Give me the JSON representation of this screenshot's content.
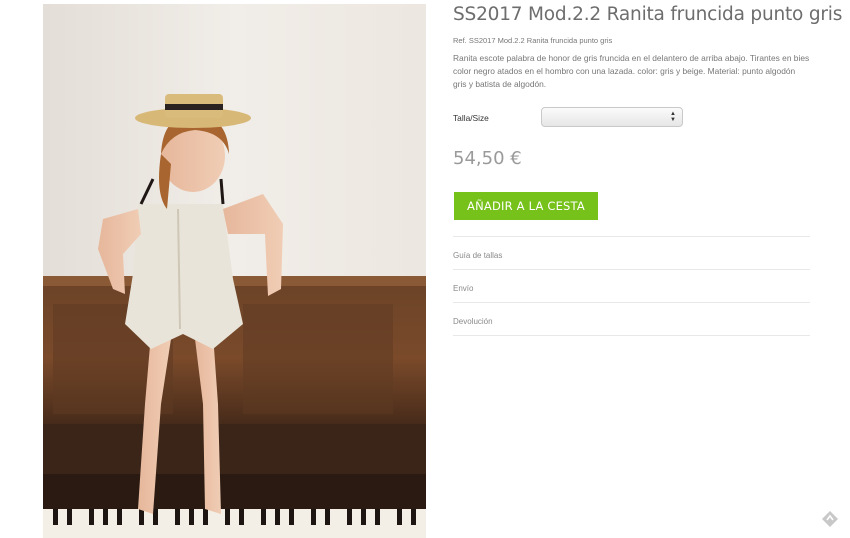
{
  "product": {
    "title": "SS2017 Mod.2.2 Ranita fruncida punto gris",
    "reference": "Ref. SS2017 Mod.2.2 Ranita fruncida punto gris",
    "description": "Ranita escote palabra de honor de gris fruncida en el delantero de arriba abajo. Tirantes en bies color negro atados en el hombro con una lazada. color: gris y beige. Material: punto algodón gris y batista de algodón.",
    "price": "54,50 €",
    "size_label": "Talla/Size",
    "size_selected": "",
    "add_to_cart": "AÑADIR A LA CESTA",
    "accent_color": "#77c11b"
  },
  "accordion": [
    {
      "label": "Guía de tallas"
    },
    {
      "label": "Envío"
    },
    {
      "label": "Devolución"
    }
  ],
  "icons": {
    "corner": "back-to-top-icon"
  }
}
